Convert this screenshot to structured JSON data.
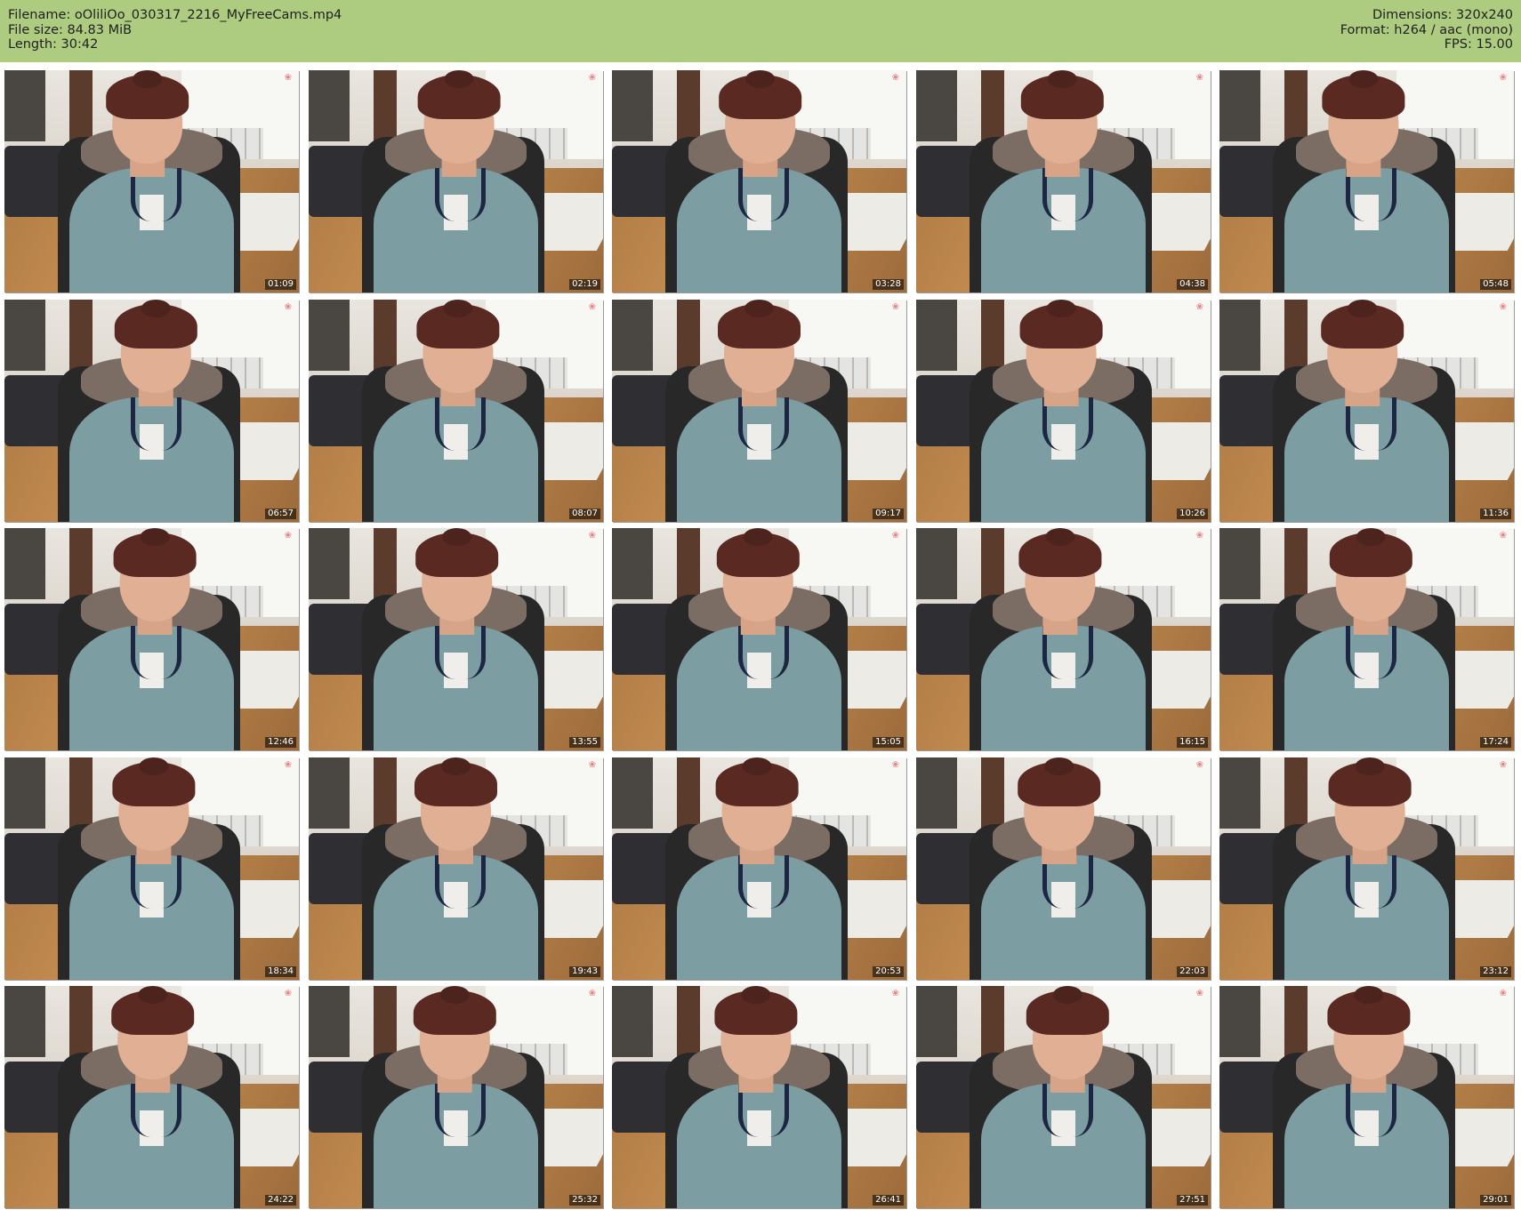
{
  "header": {
    "filename": "Filename: oOliliOo_030317_2216_MyFreeCams.mp4",
    "file_size": "File size: 84.83 MiB",
    "length": "Length: 30:42",
    "dimensions": "Dimensions: 320x240",
    "format": "Format: h264 / aac (mono)",
    "fps": "FPS: 15.00"
  },
  "colors": {
    "header_bg": "#aecc80",
    "page_bg": "#ffffff"
  },
  "thumbnails": [
    {
      "timestamp": "01:09"
    },
    {
      "timestamp": "02:19"
    },
    {
      "timestamp": "03:28"
    },
    {
      "timestamp": "04:38"
    },
    {
      "timestamp": "05:48"
    },
    {
      "timestamp": "06:57"
    },
    {
      "timestamp": "08:07"
    },
    {
      "timestamp": "09:17"
    },
    {
      "timestamp": "10:26"
    },
    {
      "timestamp": "11:36"
    },
    {
      "timestamp": "12:46"
    },
    {
      "timestamp": "13:55"
    },
    {
      "timestamp": "15:05"
    },
    {
      "timestamp": "16:15"
    },
    {
      "timestamp": "17:24"
    },
    {
      "timestamp": "18:34"
    },
    {
      "timestamp": "19:43"
    },
    {
      "timestamp": "20:53"
    },
    {
      "timestamp": "22:03"
    },
    {
      "timestamp": "23:12"
    },
    {
      "timestamp": "24:22"
    },
    {
      "timestamp": "25:32"
    },
    {
      "timestamp": "26:41"
    },
    {
      "timestamp": "27:51"
    },
    {
      "timestamp": "29:01"
    }
  ]
}
